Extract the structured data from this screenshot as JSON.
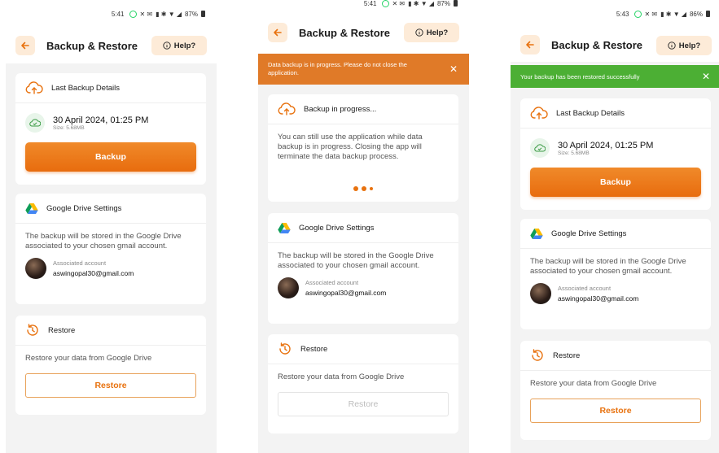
{
  "screens": [
    {
      "status": {
        "time": "5:41",
        "battery": "87%"
      },
      "header": {
        "title": "Backup & Restore",
        "help": "Help?"
      },
      "last_backup": {
        "title": "Last Backup Details",
        "date": "30 April 2024, 01:25 PM",
        "size": "Size: 5.68MB",
        "button": "Backup"
      },
      "drive": {
        "title": "Google Drive Settings",
        "desc": "The backup will be stored in the Google Drive associated to your chosen gmail account.",
        "account_label": "Associated account",
        "email": "aswingopal30@gmail.com"
      },
      "restore": {
        "title": "Restore",
        "desc": "Restore your data from Google Drive",
        "button": "Restore"
      }
    },
    {
      "status": {
        "time": "5:41",
        "battery": "87%"
      },
      "header": {
        "title": "Backup & Restore",
        "help": "Help?"
      },
      "banner": {
        "text": "Data backup is in progress. Please do not close the application.",
        "color": "#e07a28"
      },
      "progress": {
        "title": "Backup in progress...",
        "desc": "You can still use the application while data backup is in progress. Closing the app will terminate the data backup process."
      },
      "drive": {
        "title": "Google Drive Settings",
        "desc": "The backup will be stored in the Google Drive associated to your chosen gmail account.",
        "account_label": "Associated account",
        "email": "aswingopal30@gmail.com"
      },
      "restore": {
        "title": "Restore",
        "desc": "Restore your data from Google Drive",
        "button": "Restore"
      }
    },
    {
      "status": {
        "time": "5:43",
        "battery": "86%"
      },
      "header": {
        "title": "Backup & Restore",
        "help": "Help?"
      },
      "banner": {
        "text": "Your backup has been restored successfully",
        "color": "#4caf34"
      },
      "last_backup": {
        "title": "Last Backup Details",
        "date": "30 April 2024, 01:25 PM",
        "size": "Size: 5.68MB",
        "button": "Backup"
      },
      "drive": {
        "title": "Google Drive Settings",
        "desc": "The backup will be stored in the Google Drive associated to your chosen gmail account.",
        "account_label": "Associated account",
        "email": "aswingopal30@gmail.com"
      },
      "restore": {
        "title": "Restore",
        "desc": "Restore your data from Google Drive",
        "button": "Restore"
      }
    }
  ],
  "icons": {
    "back": "arrow-left-icon",
    "help": "info-icon",
    "cloud_upload": "cloud-upload-icon",
    "cloud_check": "cloud-check-icon",
    "drive": "google-drive-icon",
    "restore": "history-icon",
    "close": "close-icon"
  },
  "colors": {
    "accent": "#e8720f",
    "accent_light": "#fdebd8",
    "success": "#4caf34",
    "warning": "#e07a28"
  }
}
